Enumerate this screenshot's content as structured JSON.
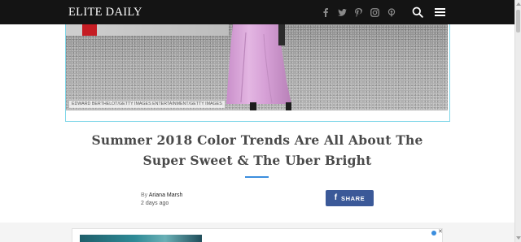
{
  "header": {
    "logo": "ELITE DAILY",
    "social_icons": [
      "facebook-icon",
      "twitter-icon",
      "pinterest-icon",
      "instagram-icon",
      "podcast-icon"
    ],
    "search_icon": "search-icon",
    "menu_icon": "hamburger-menu-icon"
  },
  "hero": {
    "photo_credit": "EDWARD BERTHELOT/GETTY IMAGES ENTERTAINMENT/GETTY IMAGES"
  },
  "article": {
    "title": "Summer 2018 Color Trends Are All About The Super Sweet & The Uber Bright",
    "byline_prefix": "By",
    "author": "Ariana Marsh",
    "date": "2 days ago"
  },
  "share": {
    "icon": "f",
    "label": "SHARE"
  },
  "ad": {
    "close_glyph": "✕"
  },
  "colors": {
    "topbar": "#141414",
    "accent_rule": "#3b8ede",
    "facebook": "#3b5998",
    "dress_pink": "#d9a6d8"
  }
}
